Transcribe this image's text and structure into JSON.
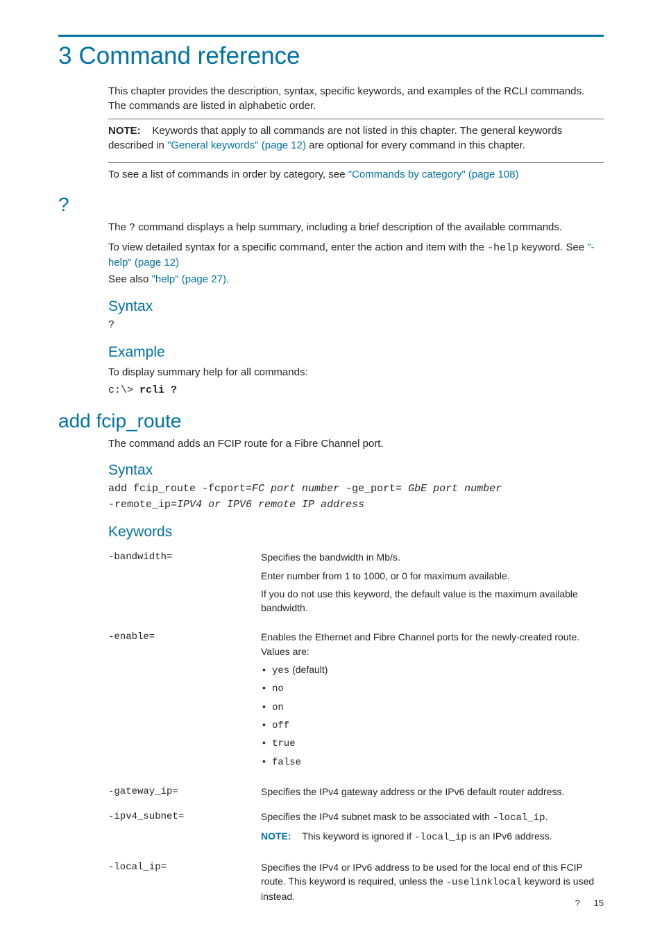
{
  "title_num": "3",
  "title": "Command reference",
  "intro": "This chapter provides the description, syntax, specific keywords, and examples of the RCLI commands. The commands are listed in alphabetic order.",
  "note_label": "NOTE:",
  "note_before": "Keywords that apply to all commands are not listed in this chapter. The general keywords described in ",
  "note_link": "\"General keywords\" (page 12)",
  "note_after": " are optional for every command in this chapter.",
  "see_before": "To see a list of commands in order by category, see ",
  "see_link": "\"Commands by category\" (page 108)",
  "sec_q": "?",
  "q_desc_a": "The ",
  "q_desc_code": "?",
  "q_desc_b": " command displays a help summary, including a brief description of the available commands.",
  "q_detail_a": "To view detailed syntax for a specific command, enter the action and item with the ",
  "q_detail_code": "-help",
  "q_detail_b": " keyword. See ",
  "q_detail_link": "\"-help\" (page 12)",
  "q_seealso_a": "See also ",
  "q_seealso_link": "\"help\" (page 27)",
  "q_seealso_b": ".",
  "h_syntax": "Syntax",
  "q_syntax": "?",
  "h_example": "Example",
  "q_example_text": "To display summary help for all commands:",
  "q_example_prompt": "c:\\> ",
  "q_example_cmd": "rcli ?",
  "sec_add": "add fcip_route",
  "add_desc": "The  command adds an FCIP route for a Fibre Channel port.",
  "add_syntax_1a": "add fcip_route -fcport=",
  "add_syntax_1b": "FC port number",
  "add_syntax_1c": " -ge_port= ",
  "add_syntax_1d": "GbE port number",
  "add_syntax_2a": "-remote_ip=",
  "add_syntax_2b": "IPV4 or IPV6 remote IP address",
  "h_keywords": "Keywords",
  "kw": [
    {
      "name": "-bandwidth=",
      "p1": "Specifies the bandwidth in Mb/s.",
      "p2": "Enter number from 1 to 1000, or 0 for maximum available.",
      "p3": "If you do not use this keyword, the default value is the maximum available bandwidth."
    },
    {
      "name": "-enable=",
      "p1": "Enables the Ethernet and Fibre Channel ports for the newly-created route. Values are:",
      "opts": [
        "yes",
        "no",
        "on",
        "off",
        "true",
        "false"
      ],
      "opt_default": " (default)"
    },
    {
      "name": "-gateway_ip=",
      "p1": "Specifies the IPv4 gateway address or the IPv6 default router address."
    },
    {
      "name": "-ipv4_subnet=",
      "p1_a": "Specifies the IPv4 subnet mask to be associated with ",
      "p1_code": "-local_ip",
      "p1_b": ".",
      "note_label": "NOTE:",
      "note_a": "This keyword is ignored if ",
      "note_code": "-local_ip",
      "note_b": " is an IPv6 address."
    },
    {
      "name": "-local_ip=",
      "p1_a": "Specifies the IPv4 or IPv6 address to be used for the local end of this FCIP route. This keyword is required, unless the ",
      "p1_code": "-uselinklocal",
      "p1_b": " keyword is used instead."
    }
  ],
  "footer_q": "?",
  "footer_page": "15"
}
